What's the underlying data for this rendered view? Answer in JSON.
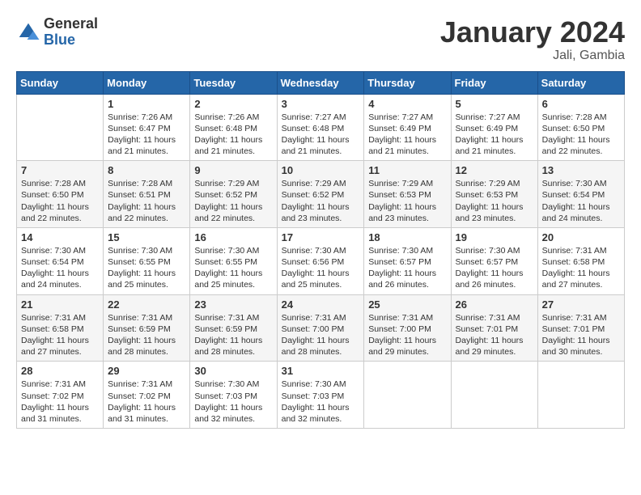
{
  "logo": {
    "general": "General",
    "blue": "Blue"
  },
  "title": "January 2024",
  "subtitle": "Jali, Gambia",
  "days_of_week": [
    "Sunday",
    "Monday",
    "Tuesday",
    "Wednesday",
    "Thursday",
    "Friday",
    "Saturday"
  ],
  "weeks": [
    [
      {
        "day": "",
        "info": ""
      },
      {
        "day": "1",
        "info": "Sunrise: 7:26 AM\nSunset: 6:47 PM\nDaylight: 11 hours and 21 minutes."
      },
      {
        "day": "2",
        "info": "Sunrise: 7:26 AM\nSunset: 6:48 PM\nDaylight: 11 hours and 21 minutes."
      },
      {
        "day": "3",
        "info": "Sunrise: 7:27 AM\nSunset: 6:48 PM\nDaylight: 11 hours and 21 minutes."
      },
      {
        "day": "4",
        "info": "Sunrise: 7:27 AM\nSunset: 6:49 PM\nDaylight: 11 hours and 21 minutes."
      },
      {
        "day": "5",
        "info": "Sunrise: 7:27 AM\nSunset: 6:49 PM\nDaylight: 11 hours and 21 minutes."
      },
      {
        "day": "6",
        "info": "Sunrise: 7:28 AM\nSunset: 6:50 PM\nDaylight: 11 hours and 22 minutes."
      }
    ],
    [
      {
        "day": "7",
        "info": "Sunrise: 7:28 AM\nSunset: 6:50 PM\nDaylight: 11 hours and 22 minutes."
      },
      {
        "day": "8",
        "info": "Sunrise: 7:28 AM\nSunset: 6:51 PM\nDaylight: 11 hours and 22 minutes."
      },
      {
        "day": "9",
        "info": "Sunrise: 7:29 AM\nSunset: 6:52 PM\nDaylight: 11 hours and 22 minutes."
      },
      {
        "day": "10",
        "info": "Sunrise: 7:29 AM\nSunset: 6:52 PM\nDaylight: 11 hours and 23 minutes."
      },
      {
        "day": "11",
        "info": "Sunrise: 7:29 AM\nSunset: 6:53 PM\nDaylight: 11 hours and 23 minutes."
      },
      {
        "day": "12",
        "info": "Sunrise: 7:29 AM\nSunset: 6:53 PM\nDaylight: 11 hours and 23 minutes."
      },
      {
        "day": "13",
        "info": "Sunrise: 7:30 AM\nSunset: 6:54 PM\nDaylight: 11 hours and 24 minutes."
      }
    ],
    [
      {
        "day": "14",
        "info": "Sunrise: 7:30 AM\nSunset: 6:54 PM\nDaylight: 11 hours and 24 minutes."
      },
      {
        "day": "15",
        "info": "Sunrise: 7:30 AM\nSunset: 6:55 PM\nDaylight: 11 hours and 25 minutes."
      },
      {
        "day": "16",
        "info": "Sunrise: 7:30 AM\nSunset: 6:55 PM\nDaylight: 11 hours and 25 minutes."
      },
      {
        "day": "17",
        "info": "Sunrise: 7:30 AM\nSunset: 6:56 PM\nDaylight: 11 hours and 25 minutes."
      },
      {
        "day": "18",
        "info": "Sunrise: 7:30 AM\nSunset: 6:57 PM\nDaylight: 11 hours and 26 minutes."
      },
      {
        "day": "19",
        "info": "Sunrise: 7:30 AM\nSunset: 6:57 PM\nDaylight: 11 hours and 26 minutes."
      },
      {
        "day": "20",
        "info": "Sunrise: 7:31 AM\nSunset: 6:58 PM\nDaylight: 11 hours and 27 minutes."
      }
    ],
    [
      {
        "day": "21",
        "info": "Sunrise: 7:31 AM\nSunset: 6:58 PM\nDaylight: 11 hours and 27 minutes."
      },
      {
        "day": "22",
        "info": "Sunrise: 7:31 AM\nSunset: 6:59 PM\nDaylight: 11 hours and 28 minutes."
      },
      {
        "day": "23",
        "info": "Sunrise: 7:31 AM\nSunset: 6:59 PM\nDaylight: 11 hours and 28 minutes."
      },
      {
        "day": "24",
        "info": "Sunrise: 7:31 AM\nSunset: 7:00 PM\nDaylight: 11 hours and 28 minutes."
      },
      {
        "day": "25",
        "info": "Sunrise: 7:31 AM\nSunset: 7:00 PM\nDaylight: 11 hours and 29 minutes."
      },
      {
        "day": "26",
        "info": "Sunrise: 7:31 AM\nSunset: 7:01 PM\nDaylight: 11 hours and 29 minutes."
      },
      {
        "day": "27",
        "info": "Sunrise: 7:31 AM\nSunset: 7:01 PM\nDaylight: 11 hours and 30 minutes."
      }
    ],
    [
      {
        "day": "28",
        "info": "Sunrise: 7:31 AM\nSunset: 7:02 PM\nDaylight: 11 hours and 31 minutes."
      },
      {
        "day": "29",
        "info": "Sunrise: 7:31 AM\nSunset: 7:02 PM\nDaylight: 11 hours and 31 minutes."
      },
      {
        "day": "30",
        "info": "Sunrise: 7:30 AM\nSunset: 7:03 PM\nDaylight: 11 hours and 32 minutes."
      },
      {
        "day": "31",
        "info": "Sunrise: 7:30 AM\nSunset: 7:03 PM\nDaylight: 11 hours and 32 minutes."
      },
      {
        "day": "",
        "info": ""
      },
      {
        "day": "",
        "info": ""
      },
      {
        "day": "",
        "info": ""
      }
    ]
  ]
}
